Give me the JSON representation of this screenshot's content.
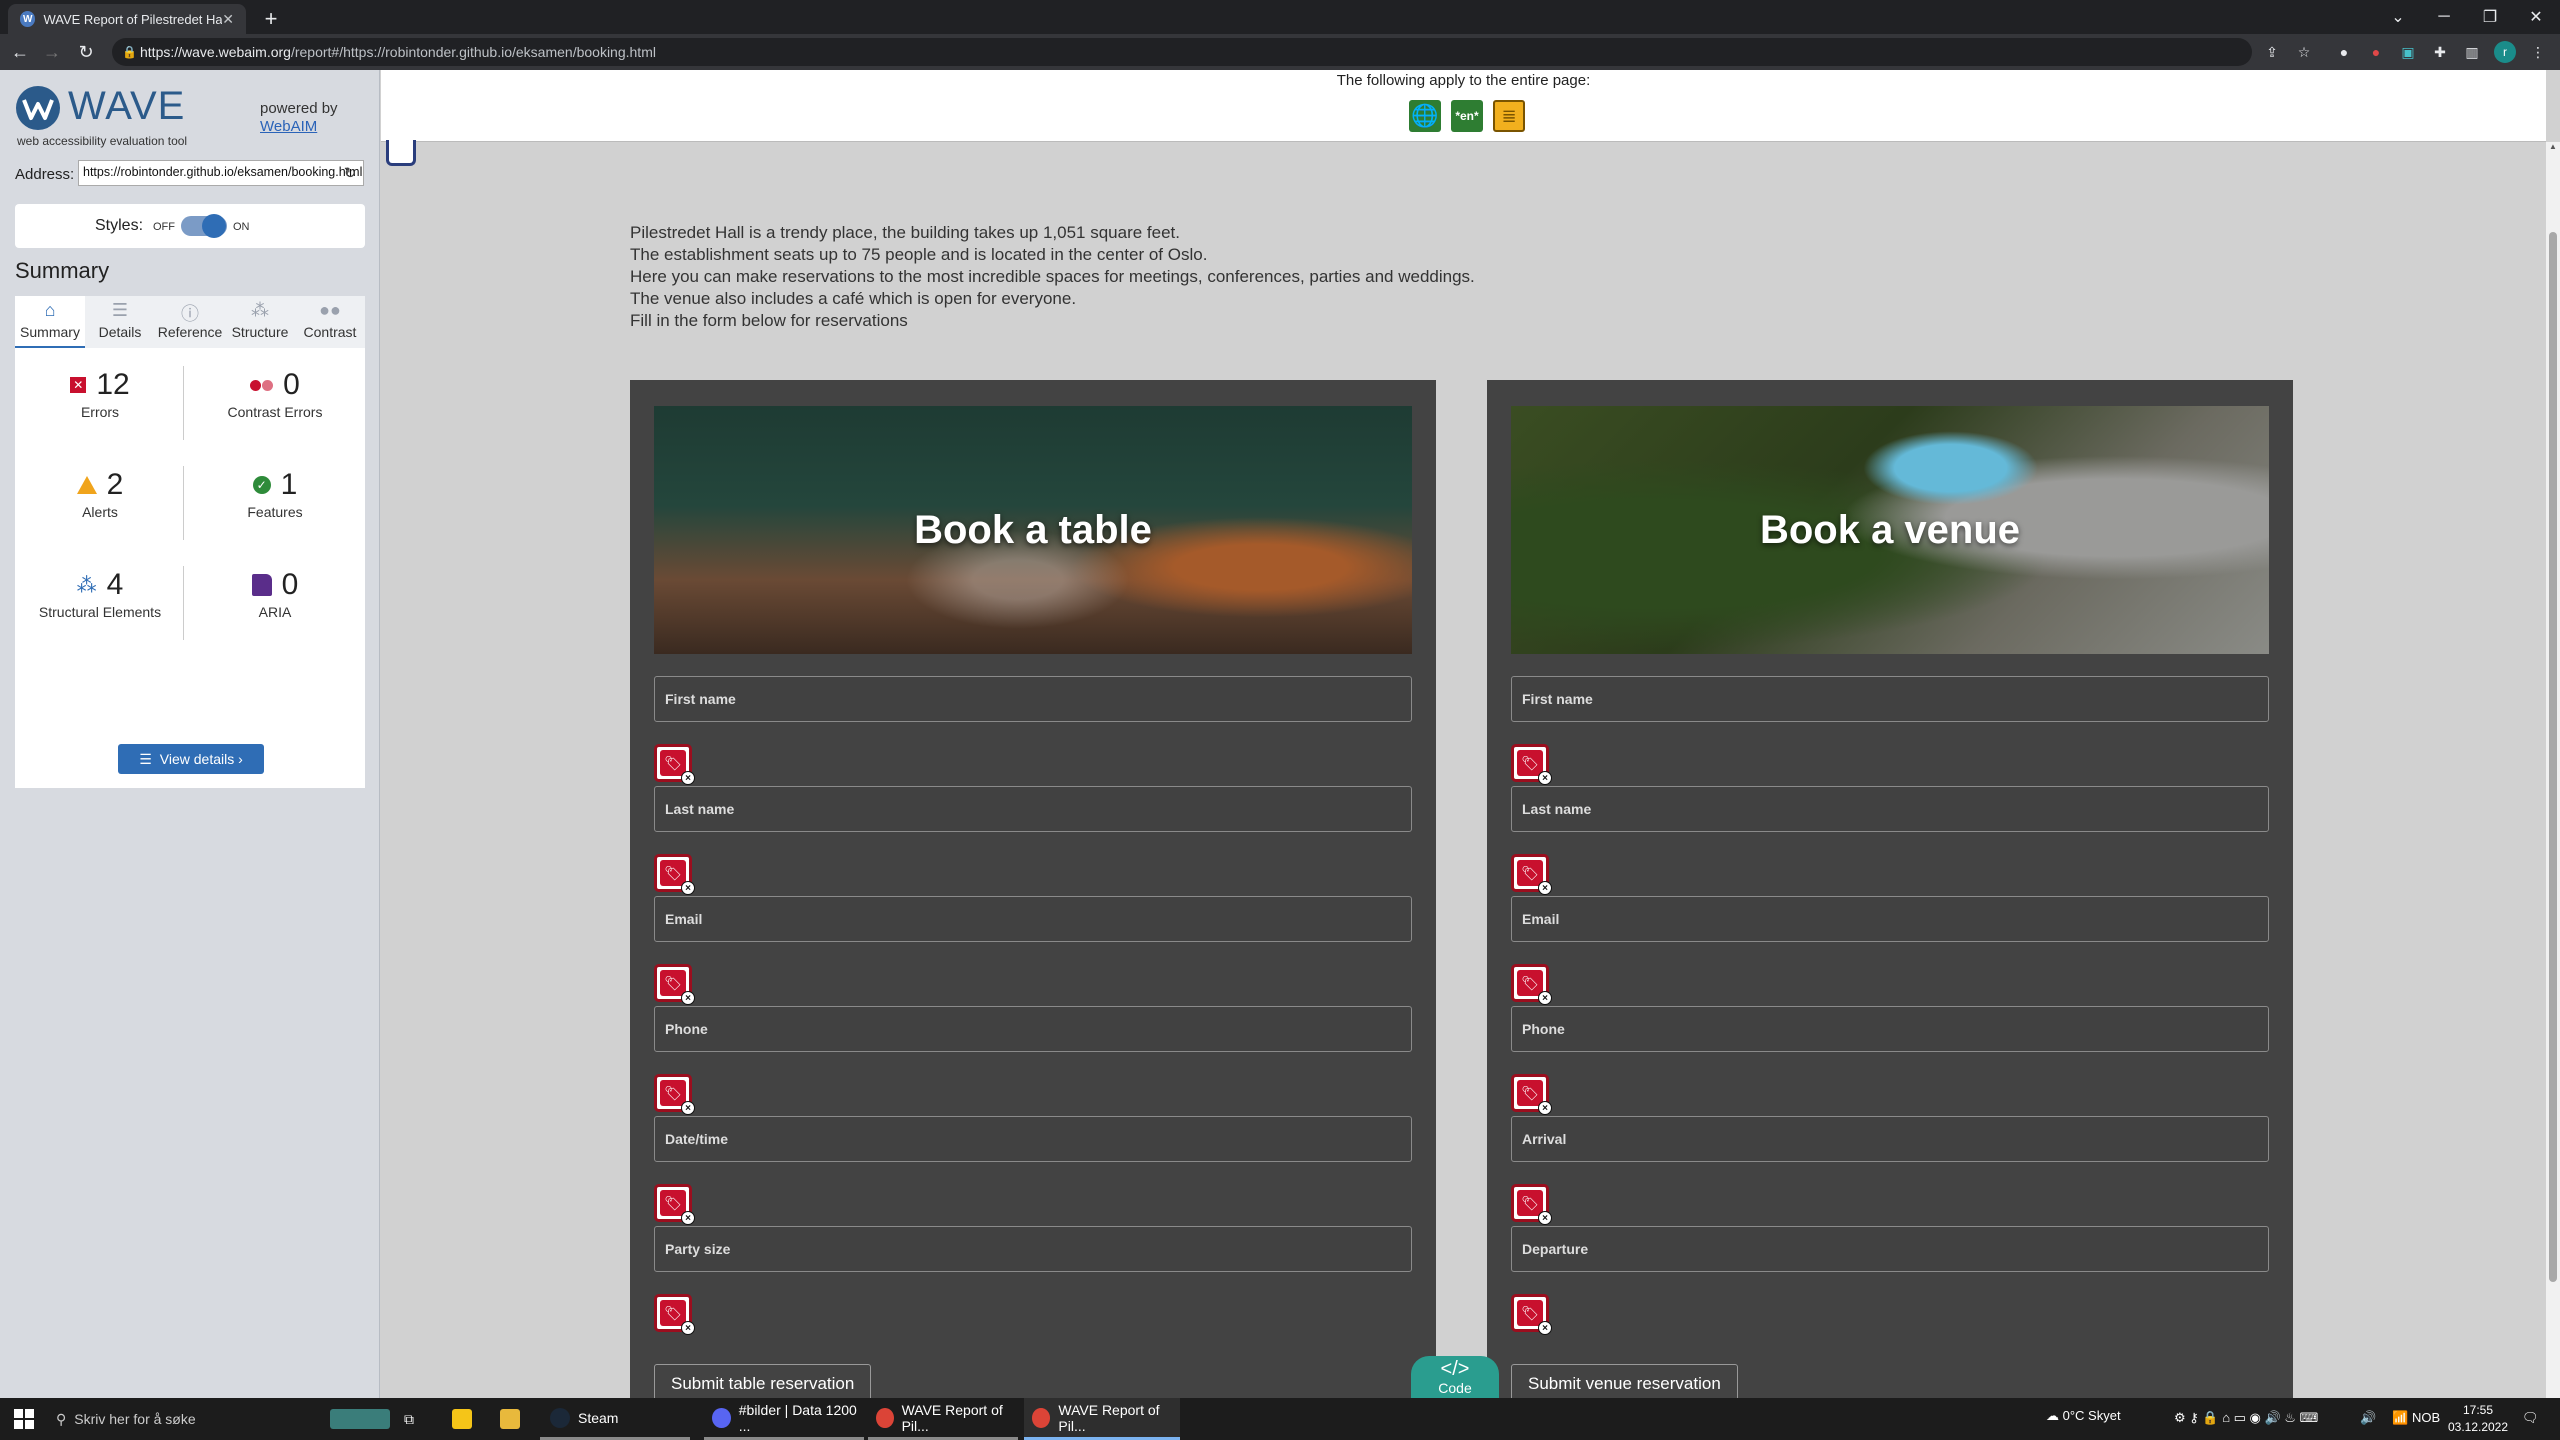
{
  "browser": {
    "tab_title": "WAVE Report of Pilestredet Hall",
    "tab_favicon": "W",
    "url_host": "https://wave.webaim.org",
    "url_rest": "/report#/https://robintonder.github.io/eksamen/booking.html",
    "profile_initial": "r"
  },
  "wave": {
    "title": "WAVE",
    "subtitle": "web accessibility evaluation tool",
    "powered_by": "powered by",
    "webaim_link": "WebAIM",
    "address_label": "Address:",
    "address_value": "https://robintonder.github.io/eksamen/booking.html",
    "styles_label": "Styles:",
    "styles_off": "OFF",
    "styles_on": "ON",
    "summary_heading": "Summary",
    "tabs": [
      {
        "label": "Summary",
        "icon": "home-icon"
      },
      {
        "label": "Details",
        "icon": "list-icon"
      },
      {
        "label": "Reference",
        "icon": "info-icon"
      },
      {
        "label": "Structure",
        "icon": "structure-icon"
      },
      {
        "label": "Contrast",
        "icon": "contrast-icon"
      }
    ],
    "stats": {
      "errors": {
        "count": "12",
        "label": "Errors"
      },
      "contrast_errors": {
        "count": "0",
        "label": "Contrast Errors"
      },
      "alerts": {
        "count": "2",
        "label": "Alerts"
      },
      "features": {
        "count": "1",
        "label": "Features"
      },
      "structural": {
        "count": "4",
        "label": "Structural Elements"
      },
      "aria": {
        "count": "0",
        "label": "ARIA"
      }
    },
    "view_details": "View details ›"
  },
  "page": {
    "head_note": "The following apply to the entire page:",
    "lang_badge": "*en*",
    "intro_lines": [
      "Pilestredet Hall is a trendy place, the building takes up 1,051 square feet.",
      "The establishment seats up to 75 people and is located in the center of Oslo.",
      "Here you can make reservations to the most incredible spaces for meetings, conferences, parties and weddings.",
      "The venue also includes a café which is open for everyone.",
      "Fill in the form below for reservations"
    ],
    "table_card": {
      "title": "Book a table",
      "fields": [
        "First name",
        "Last name",
        "Email",
        "Phone",
        "Date/time",
        "Party size"
      ],
      "submit": "Submit table reservation"
    },
    "venue_card": {
      "title": "Book a venue",
      "fields": [
        "First name",
        "Last name",
        "Email",
        "Phone",
        "Arrival",
        "Departure"
      ],
      "submit": "Submit venue reservation"
    },
    "code_button": {
      "symbol": "</>",
      "label": "Code"
    }
  },
  "taskbar": {
    "search_placeholder": "Skriv her for å søke",
    "steam": "Steam",
    "discord": "#bilder | Data 1200 ...",
    "chrome1": "WAVE Report of Pil...",
    "chrome2": "WAVE Report of Pil...",
    "weather": "0°C  Skyet",
    "lang": "NOB",
    "time": "17:55",
    "date": "03.12.2022"
  },
  "colors": {
    "wave_blue": "#2f6db5",
    "error_red": "#c8102e",
    "alert_orange": "#f0a41c",
    "feature_green": "#2e8b3a",
    "aria_purple": "#5a2d8a",
    "card_bg": "#434343",
    "code_teal": "#2a9d8f"
  }
}
